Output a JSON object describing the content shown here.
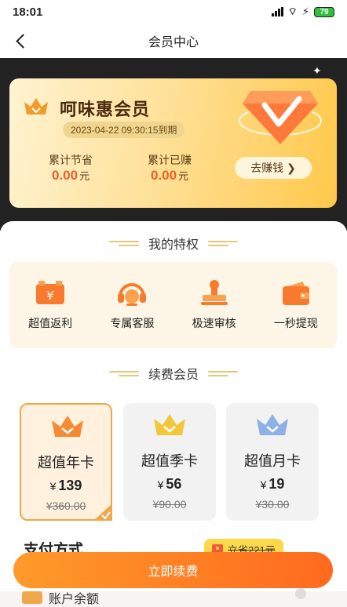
{
  "status_bar": {
    "time": "18:01",
    "battery": "79"
  },
  "header": {
    "title": "会员中心"
  },
  "vip_card": {
    "name": "呵味惠会员",
    "expire": "2023-04-22 09:30:15到期",
    "saved_label": "累计节省",
    "saved_value": "0.00",
    "saved_unit": "元",
    "earned_label": "累计已赚",
    "earned_value": "0.00",
    "earned_unit": "元",
    "earn_button": "去赚钱 ❯"
  },
  "privileges": {
    "title": "我的特权",
    "items": [
      {
        "label": "超值返利",
        "icon": "wallet-yen-icon"
      },
      {
        "label": "专属客服",
        "icon": "headset-icon"
      },
      {
        "label": "极速审核",
        "icon": "stamp-icon"
      },
      {
        "label": "一秒提现",
        "icon": "wallet-icon"
      }
    ]
  },
  "renewal": {
    "title": "续费会员",
    "plans": [
      {
        "name": "超值年卡",
        "currency": "¥",
        "price": "139",
        "original": "¥360.00",
        "selected": true
      },
      {
        "name": "超值季卡",
        "currency": "¥",
        "price": "56",
        "original": "¥90.00",
        "selected": false
      },
      {
        "name": "超值月卡",
        "currency": "¥",
        "price": "19",
        "original": "¥30.00",
        "selected": false
      }
    ]
  },
  "payment": {
    "title": "支付方式",
    "save_tag": "立省221元",
    "renew_button": "立即续费",
    "balance_label": "账户余额"
  },
  "colors": {
    "accent": "#ff7a22",
    "price_red": "#e7612a",
    "gold": "#ffc84a"
  }
}
